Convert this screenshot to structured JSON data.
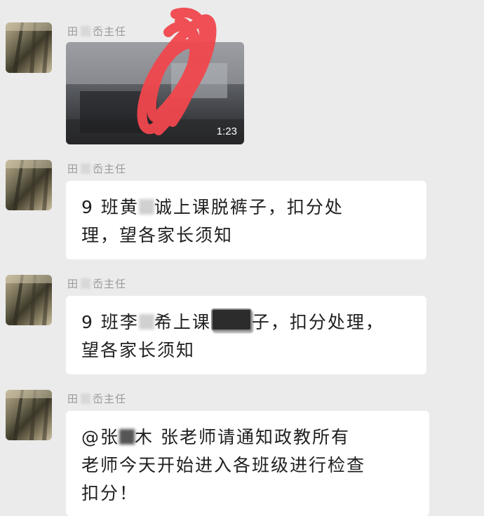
{
  "messages": [
    {
      "sender_prefix": "田",
      "sender_suffix": "岙主任",
      "type": "video",
      "video_duration": "1:23"
    },
    {
      "sender_prefix": "田",
      "sender_suffix": "岙主任",
      "type": "text",
      "line1_a": "9 班黄",
      "line1_b": "诚上课脱裤",
      "line1_c": "子，扣分处",
      "line2": "理，望各家长须知"
    },
    {
      "sender_prefix": "田",
      "sender_suffix": "岙主任",
      "type": "text",
      "line1_a": "9 班李",
      "line1_b": "希上课",
      "line1_c": "子，扣分处理，",
      "line2": "望各家长须知"
    },
    {
      "sender_prefix": "田",
      "sender_suffix": "岙主任",
      "type": "text",
      "line1_a": "@张",
      "line1_b": "木  张老师请通知政教所有",
      "line2": "老师今天开始进入各班级进行检查",
      "line3": "扣分！"
    }
  ]
}
